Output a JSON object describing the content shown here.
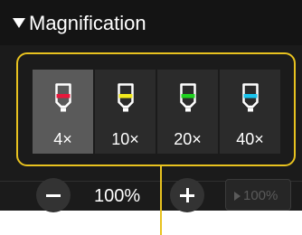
{
  "header": {
    "title": "Magnification",
    "toggle_icon": "collapse-triangle-icon"
  },
  "magnifications": [
    {
      "label": "4×",
      "color": "#e8183c",
      "selected": true
    },
    {
      "label": "10×",
      "color": "#f2ea1d",
      "selected": false
    },
    {
      "label": "20×",
      "color": "#1fd21f",
      "selected": false
    },
    {
      "label": "40×",
      "color": "#18c4ee",
      "selected": false
    }
  ],
  "zoom": {
    "value": "100%",
    "minus_icon": "minus-icon",
    "plus_icon": "plus-icon",
    "apply_label": "100%",
    "apply_enabled": false
  },
  "colors": {
    "accent": "#e8c21f",
    "panel": "#1b1b1b",
    "selected": "#5a5a5a"
  }
}
